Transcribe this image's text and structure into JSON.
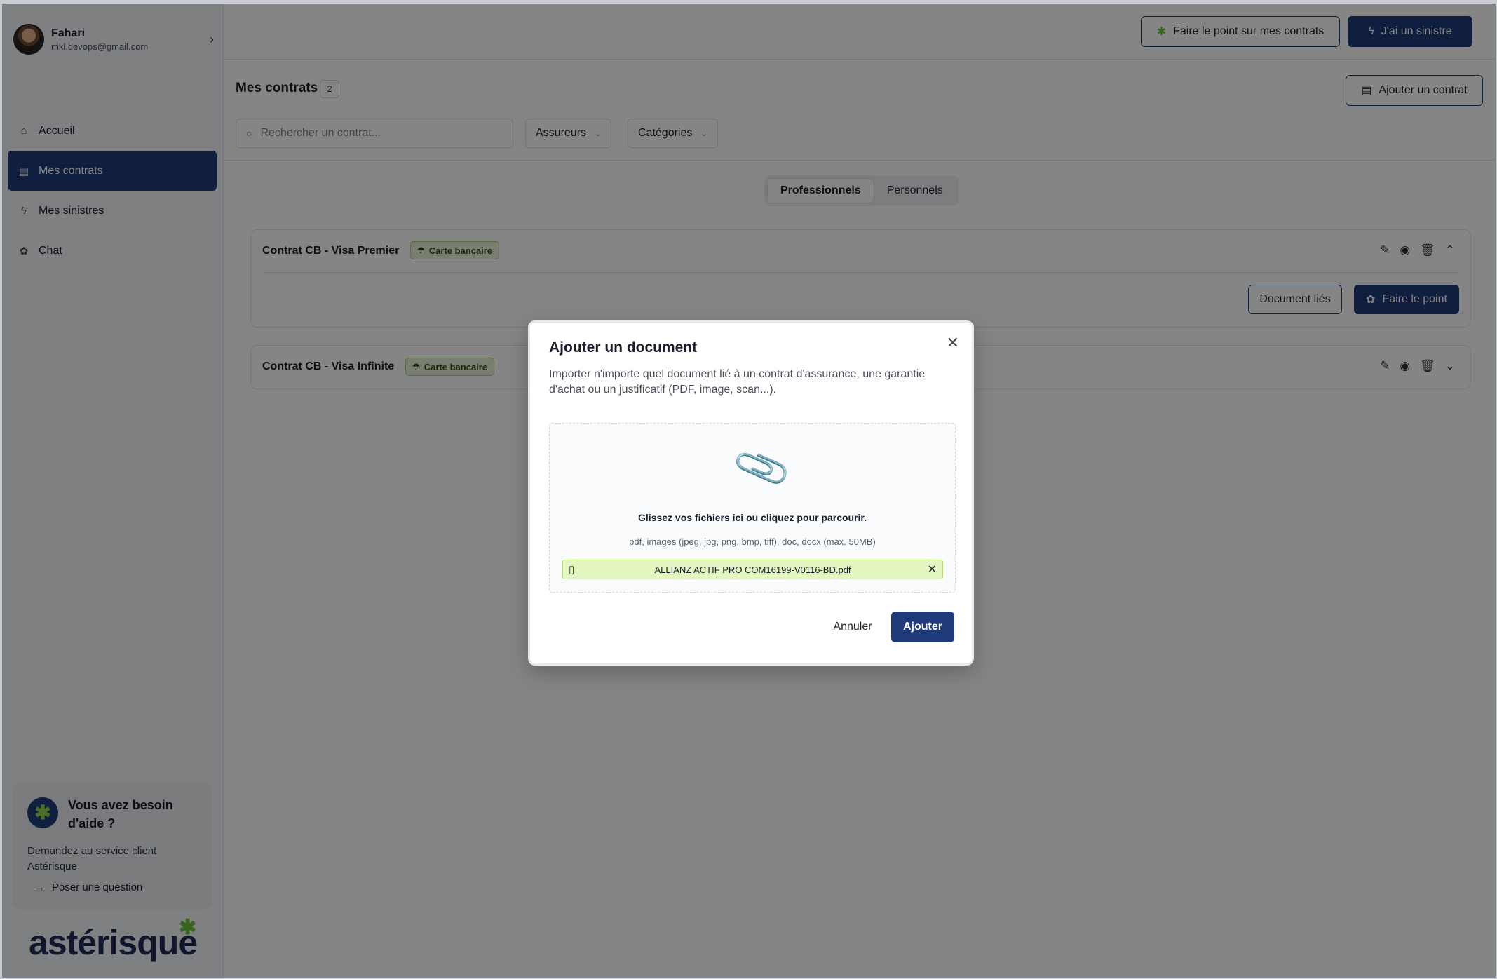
{
  "user": {
    "name": "Fahari",
    "email": "mkl.devops@gmail.com"
  },
  "sidebar": {
    "items": [
      {
        "label": "Accueil",
        "icon": "home-icon"
      },
      {
        "label": "Mes contrats",
        "icon": "document-icon",
        "active": true
      },
      {
        "label": "Mes sinistres",
        "icon": "bolt-icon"
      },
      {
        "label": "Chat",
        "icon": "flower-icon"
      }
    ],
    "help": {
      "title": "Vous avez besoin d'aide ?",
      "description": "Demandez au service client Astérisque",
      "link": "Poser une question"
    },
    "logo": "astérisque"
  },
  "header": {
    "review_button": "Faire le point sur mes contrats",
    "claim_button": "J'ai un sinistre"
  },
  "main": {
    "title": "Mes contrats",
    "count": "2",
    "add_contract_button": "Ajouter un contrat",
    "search_placeholder": "Rechercher un contrat...",
    "filters": {
      "insurers": "Assureurs",
      "categories": "Catégories"
    },
    "tabs": [
      {
        "label": "Professionnels",
        "active": true
      },
      {
        "label": "Personnels"
      }
    ],
    "contracts": [
      {
        "title": "Contrat CB - Visa Premier",
        "tag": "Carte bancaire",
        "expanded": true,
        "linked_docs_button": "Document liés",
        "review_button": "Faire le point"
      },
      {
        "title": "Contrat CB - Visa Infinite",
        "tag": "Carte bancaire",
        "expanded": false
      }
    ]
  },
  "modal": {
    "title": "Ajouter un document",
    "description": "Importer n'importe quel document lié à un contrat d'assurance, une garantie d'achat ou un justificatif (PDF, image, scan...).",
    "dropzone_main": "Glissez vos fichiers ici ou cliquez pour parcourir.",
    "dropzone_formats": "pdf, images (jpeg, jpg, png, bmp, tiff), doc, docx (max. 50MB)",
    "file_name": "ALLIANZ ACTIF PRO COM16199-V0116-BD.pdf",
    "cancel_button": "Annuler",
    "submit_button": "Ajouter"
  },
  "colors": {
    "primary": "#1f3a7a",
    "accent_green": "#8fd14f",
    "tag_bg": "#e6f4d6"
  }
}
